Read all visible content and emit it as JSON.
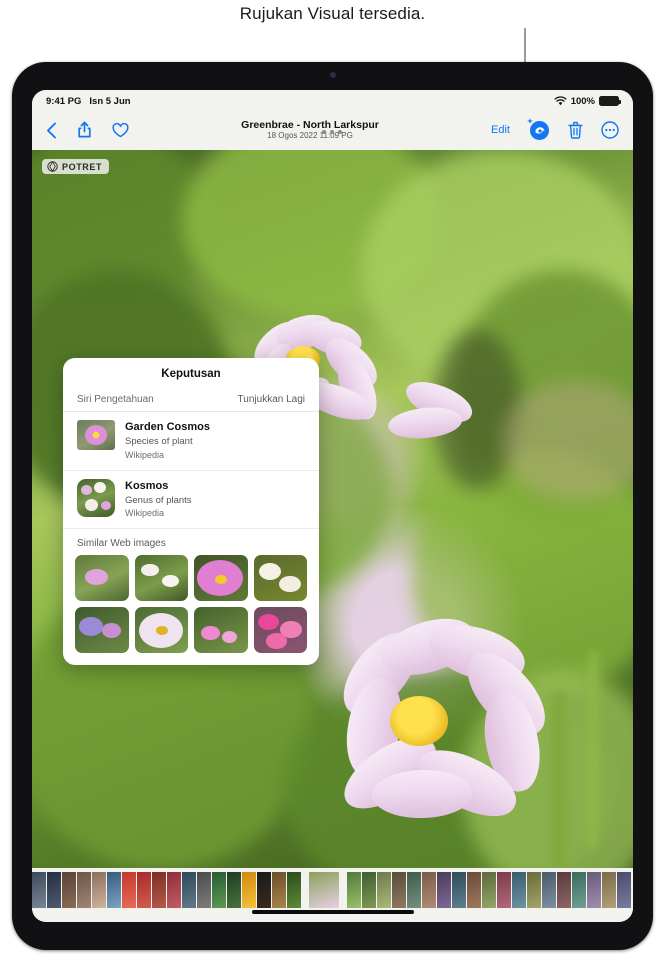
{
  "callout": {
    "text": "Rujukan Visual tersedia."
  },
  "status_bar": {
    "time": "9:41 PG",
    "date": "Isn 5 Jun",
    "battery_percent": "100%",
    "wifi_icon": "wifi-icon",
    "battery_icon": "battery-icon"
  },
  "toolbar": {
    "back_icon": "chevron-left-icon",
    "share_icon": "share-icon",
    "favorite_icon": "heart-icon",
    "title": "Greenbrae - North Larkspur",
    "subtitle": "18 Ogos 2022  11:09 PG",
    "edit_label": "Edit",
    "visual_lookup_icon": "visual-lookup-icon",
    "delete_icon": "trash-icon",
    "more_icon": "ellipsis-circle-icon",
    "handle_icon": "grabber-dots-icon"
  },
  "photo": {
    "badge_label": "POTRET",
    "badge_icon": "portrait-aperture-icon"
  },
  "results_panel": {
    "title": "Keputusan",
    "section_label": "Siri Pengetahuan",
    "show_more_label": "Tunjukkan Lagi",
    "entries": [
      {
        "title": "Garden Cosmos",
        "subtitle": "Species of plant",
        "source": "Wikipedia",
        "thumb": "garden-cosmos-thumb"
      },
      {
        "title": "Kosmos",
        "subtitle": "Genus of plants",
        "source": "Wikipedia",
        "thumb": "kosmos-thumb"
      }
    ],
    "similar_images_label": "Similar Web images",
    "similar_images_count": 8
  },
  "filmstrip": {
    "selected_index": 18,
    "thumbnail_count": 38,
    "home_indicator": "home-indicator"
  },
  "colors": {
    "accent_blue": "#1277f0",
    "screen_bg": "#f2f2ee",
    "bezel": "#111114",
    "panel_bg": "#ffffff"
  }
}
